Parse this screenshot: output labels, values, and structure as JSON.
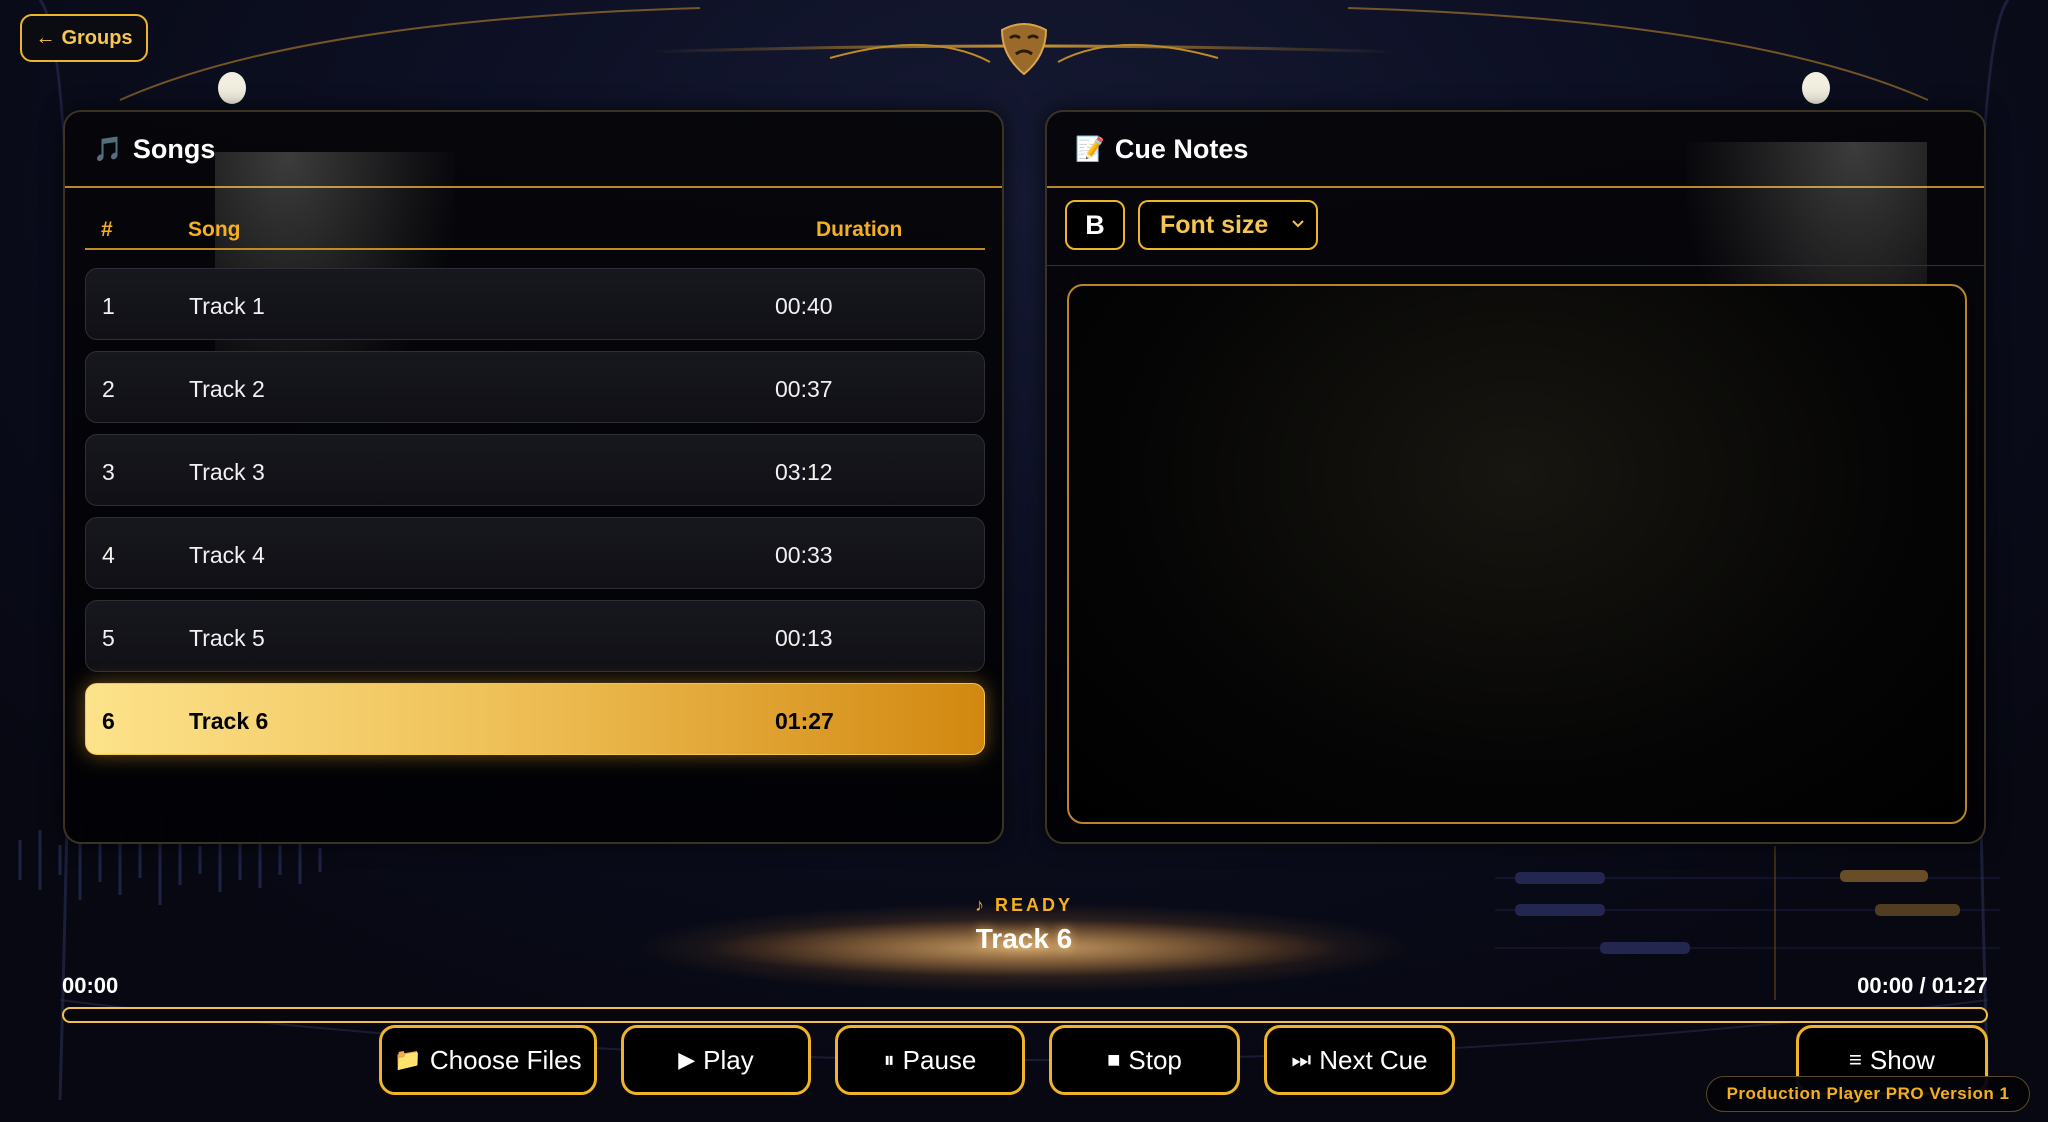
{
  "nav": {
    "back_label": "Groups",
    "back_icon": "arrow-left-icon"
  },
  "songs_panel": {
    "title": "Songs",
    "icon": "music-note-icon",
    "columns": {
      "number": "#",
      "song": "Song",
      "duration": "Duration"
    },
    "rows": [
      {
        "num": "1",
        "song": "Track 1",
        "duration": "00:40",
        "active": false
      },
      {
        "num": "2",
        "song": "Track 2",
        "duration": "00:37",
        "active": false
      },
      {
        "num": "3",
        "song": "Track 3",
        "duration": "03:12",
        "active": false
      },
      {
        "num": "4",
        "song": "Track 4",
        "duration": "00:33",
        "active": false
      },
      {
        "num": "5",
        "song": "Track 5",
        "duration": "00:13",
        "active": false
      },
      {
        "num": "6",
        "song": "Track 6",
        "duration": "01:27",
        "active": true
      }
    ]
  },
  "cue_panel": {
    "title": "Cue Notes",
    "icon": "memo-icon",
    "bold_label": "B",
    "font_size_label": "Font size",
    "notes_text": ""
  },
  "player": {
    "status": "♪ READY",
    "now_playing": "Track 6",
    "elapsed": "00:00",
    "time_total": "00:00 / 01:27",
    "progress_percent": 0
  },
  "controls": {
    "choose_files": "Choose Files",
    "play": "Play",
    "pause": "Pause",
    "stop": "Stop",
    "next_cue": "Next Cue",
    "show": "Show"
  },
  "footer": {
    "version": "Production Player PRO Version 1"
  },
  "colors": {
    "accent": "#f0b429",
    "active_row_start": "#fde38b",
    "active_row_end": "#d28810",
    "background": "#0d1024"
  }
}
